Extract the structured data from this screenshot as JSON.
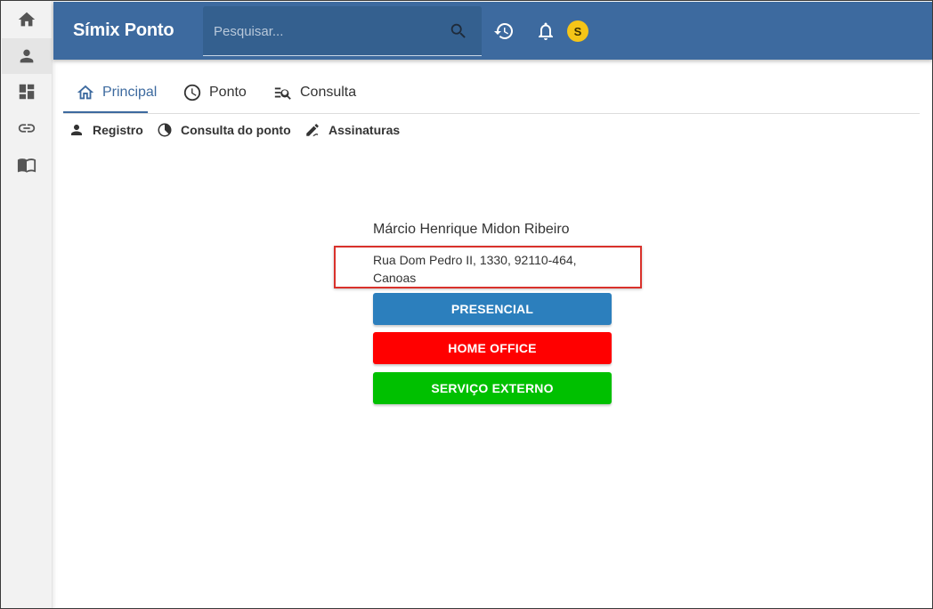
{
  "app": {
    "title": "Símix Ponto"
  },
  "search": {
    "placeholder": "Pesquisar..."
  },
  "header": {
    "avatar_initial": "S"
  },
  "sidebar": {
    "items": [
      {
        "name": "home",
        "icon": "home-icon"
      },
      {
        "name": "person",
        "icon": "person-icon"
      },
      {
        "name": "dashboard",
        "icon": "dashboard-icon"
      },
      {
        "name": "link",
        "icon": "link-icon"
      },
      {
        "name": "book",
        "icon": "book-icon"
      }
    ]
  },
  "tabs": [
    {
      "label": "Principal",
      "icon": "home-outline-icon",
      "active": true
    },
    {
      "label": "Ponto",
      "icon": "clock-icon"
    },
    {
      "label": "Consulta",
      "icon": "list-search-icon"
    }
  ],
  "subtabs": [
    {
      "label": "Registro",
      "icon": "person-icon"
    },
    {
      "label": "Consulta do ponto",
      "icon": "pie-chart-icon"
    },
    {
      "label": "Assinaturas",
      "icon": "signature-icon"
    }
  ],
  "employee": {
    "name": "Márcio Henrique Midon Ribeiro",
    "address": "Rua Dom Pedro II, 1330, 92110-464, Canoas"
  },
  "actions": [
    {
      "label": "PRESENCIAL",
      "color": "#2c7fbd"
    },
    {
      "label": "HOME OFFICE",
      "color": "#ff0000"
    },
    {
      "label": "SERVIÇO EXTERNO",
      "color": "#00c000"
    }
  ],
  "colors": {
    "appbar": "#3d6a9f",
    "accent": "#3d6a9f",
    "highlight_border": "#d9312b",
    "avatar": "#f5c518"
  }
}
